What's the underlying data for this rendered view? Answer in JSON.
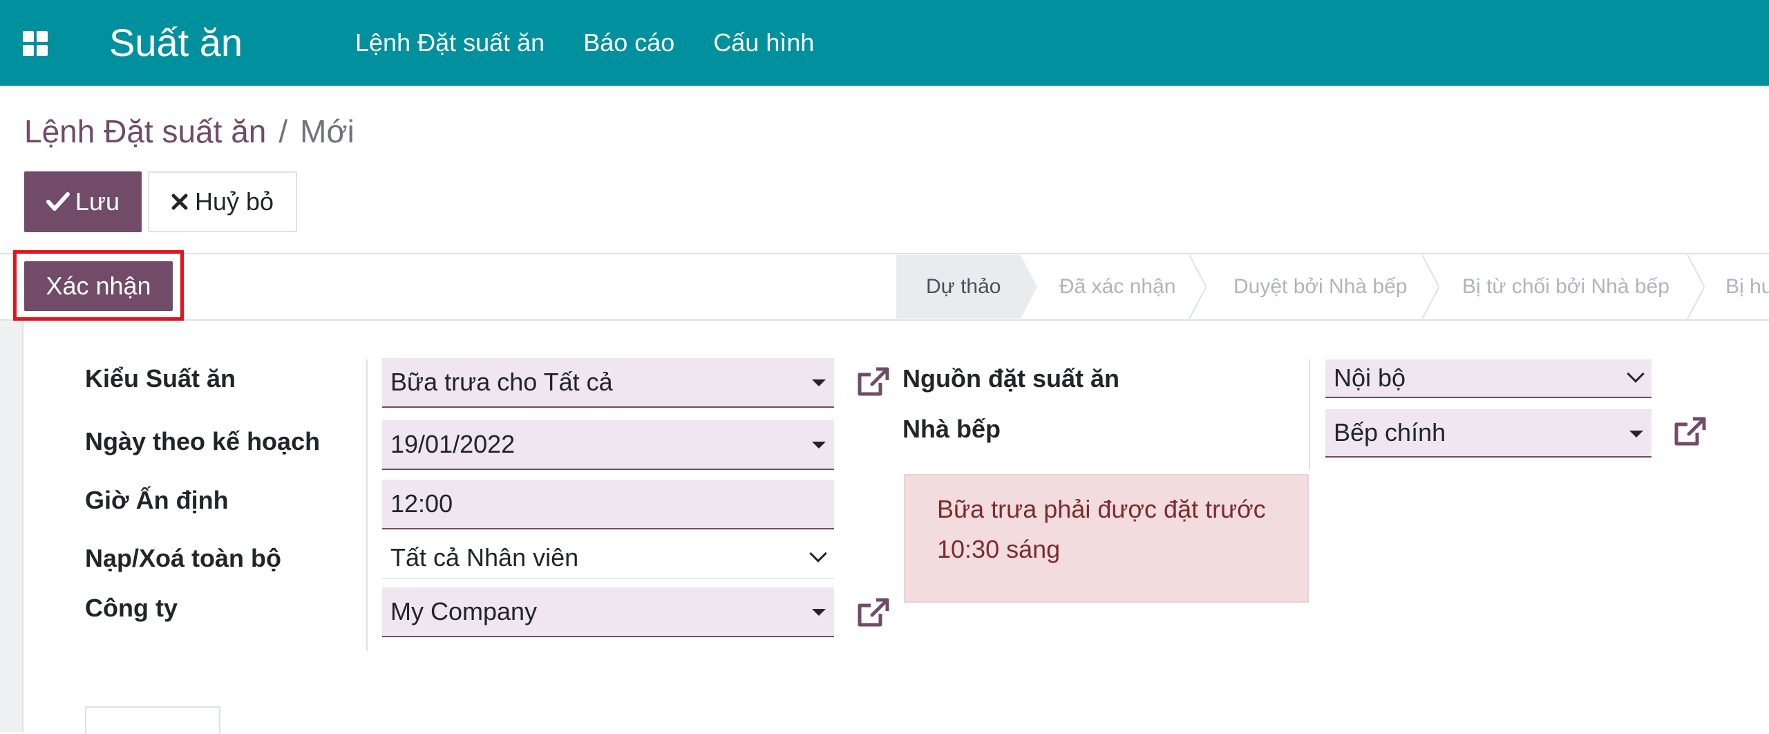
{
  "navbar": {
    "app_title": "Suất ăn",
    "menu": [
      "Lệnh Đặt suất ăn",
      "Báo cáo",
      "Cấu hình"
    ],
    "background": "#01909e"
  },
  "breadcrumb": {
    "parent": "Lệnh Đặt suất ăn",
    "separator": "/",
    "current": "Mới"
  },
  "toolbar": {
    "save_label": "Lưu",
    "discard_label": "Huỷ bỏ"
  },
  "statusbar": {
    "confirm_label": "Xác nhận",
    "stages": [
      "Dự thảo",
      "Đã xác nhận",
      "Duyệt bởi Nhà bếp",
      "Bị từ chối bởi Nhà bếp",
      "Bị hu"
    ],
    "active_stage": "Dự thảo"
  },
  "form": {
    "left": [
      {
        "label": "Kiểu Suất ăn",
        "value": "Bữa trưa cho Tất cả",
        "widget": "many2one"
      },
      {
        "label": "Ngày theo kế hoạch",
        "value": "19/01/2022",
        "widget": "date"
      },
      {
        "label": "Giờ Ấn định",
        "value": "12:00",
        "widget": "char"
      },
      {
        "label": "Nạp/Xoá toàn bộ",
        "value": "Tất cả Nhân viên",
        "widget": "selection"
      },
      {
        "label": "Công ty",
        "value": "My Company",
        "widget": "many2one"
      }
    ],
    "right": [
      {
        "label": "Nguồn đặt suất ăn",
        "value": "Nội bộ",
        "widget": "selection"
      },
      {
        "label": "Nhà bếp",
        "value": "Bếp chính",
        "widget": "many2one"
      }
    ],
    "alert": {
      "line1": "Bữa trưa phải được đặt trước",
      "line2": "10:30 sáng"
    }
  },
  "colors": {
    "primary": "#714b67",
    "field_bg": "#efe6f1",
    "alert_bg": "#f2dcde",
    "highlight": "#e0141d"
  }
}
